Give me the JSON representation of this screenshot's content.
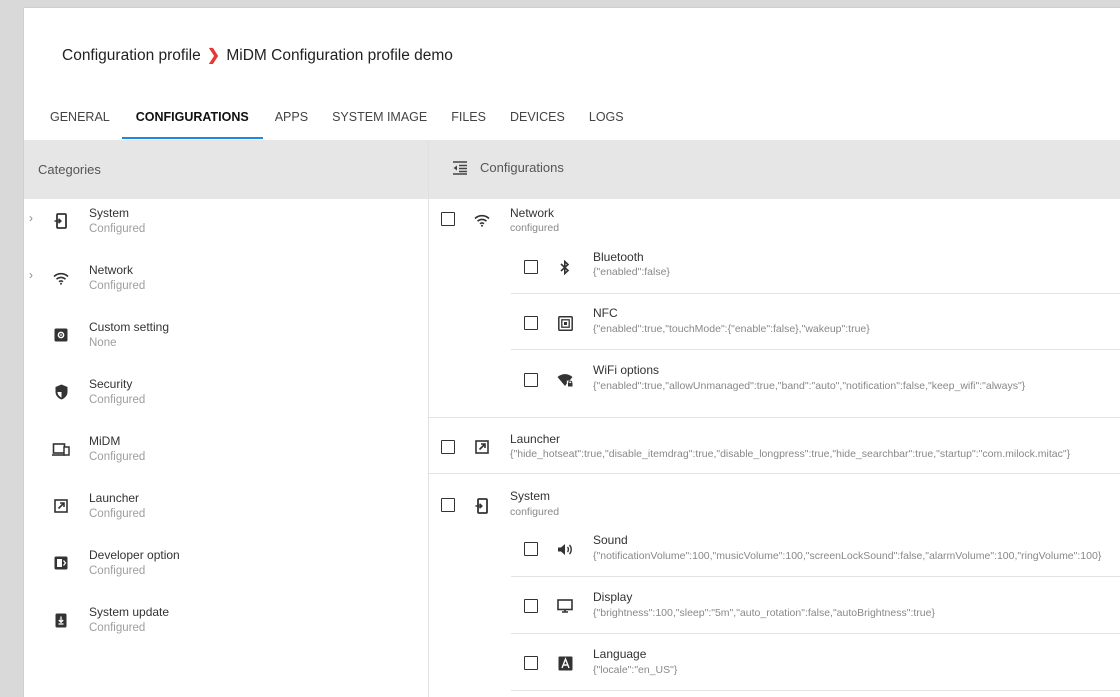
{
  "breadcrumb": {
    "parent": "Configuration profile",
    "separator": "›",
    "current": "MiDM Configuration profile demo"
  },
  "tabs": [
    {
      "label": "GENERAL",
      "active": false
    },
    {
      "label": "CONFIGURATIONS",
      "active": true
    },
    {
      "label": "APPS",
      "active": false
    },
    {
      "label": "SYSTEM IMAGE",
      "active": false
    },
    {
      "label": "FILES",
      "active": false
    },
    {
      "label": "DEVICES",
      "active": false
    },
    {
      "label": "LOGS",
      "active": false
    }
  ],
  "categories_header": "Categories",
  "configurations_header": "Configurations",
  "categories": [
    {
      "name": "System",
      "status": "Configured",
      "icon": "system-icon",
      "expandable": true
    },
    {
      "name": "Network",
      "status": "Configured",
      "icon": "wifi-icon",
      "expandable": true
    },
    {
      "name": "Custom setting",
      "status": "None",
      "icon": "custom-setting-icon",
      "expandable": false
    },
    {
      "name": "Security",
      "status": "Configured",
      "icon": "security-shield-icon",
      "expandable": false
    },
    {
      "name": "MiDM",
      "status": "Configured",
      "icon": "midm-devices-icon",
      "expandable": false
    },
    {
      "name": "Launcher",
      "status": "Configured",
      "icon": "launcher-icon",
      "expandable": false
    },
    {
      "name": "Developer option",
      "status": "Configured",
      "icon": "developer-option-icon",
      "expandable": false
    },
    {
      "name": "System update",
      "status": "Configured",
      "icon": "system-update-icon",
      "expandable": false
    }
  ],
  "configurations": {
    "network": {
      "name": "Network",
      "status": "configured",
      "icon": "wifi-icon",
      "children": [
        {
          "name": "Bluetooth",
          "value": "{\"enabled\":false}",
          "icon": "bluetooth-icon"
        },
        {
          "name": "NFC",
          "value": "{\"enabled\":true,\"touchMode\":{\"enable\":false},\"wakeup\":true}",
          "icon": "nfc-icon"
        },
        {
          "name": "WiFi options",
          "value": "{\"enabled\":true,\"allowUnmanaged\":true,\"band\":\"auto\",\"notification\":false,\"keep_wifi\":\"always\"}",
          "icon": "wifi-lock-icon"
        }
      ]
    },
    "launcher": {
      "name": "Launcher",
      "icon": "launcher-icon",
      "value": "{\"hide_hotseat\":true,\"disable_itemdrag\":true,\"disable_longpress\":true,\"hide_searchbar\":true,\"startup\":\"com.milock.mitac\"}"
    },
    "system": {
      "name": "System",
      "status": "configured",
      "icon": "system-icon",
      "children": [
        {
          "name": "Sound",
          "value": "{\"notificationVolume\":100,\"musicVolume\":100,\"screenLockSound\":false,\"alarmVolume\":100,\"ringVolume\":100}",
          "icon": "volume-icon"
        },
        {
          "name": "Display",
          "value": "{\"brightness\":100,\"sleep\":\"5m\",\"auto_rotation\":false,\"autoBrightness\":true}",
          "icon": "display-icon"
        },
        {
          "name": "Language",
          "value": "{\"locale\":\"en_US\"}",
          "icon": "language-icon"
        }
      ]
    }
  },
  "colors": {
    "accent": "#1e88e5",
    "breadcrumb_separator": "#e53935",
    "header_band": "#e6e6e6"
  }
}
